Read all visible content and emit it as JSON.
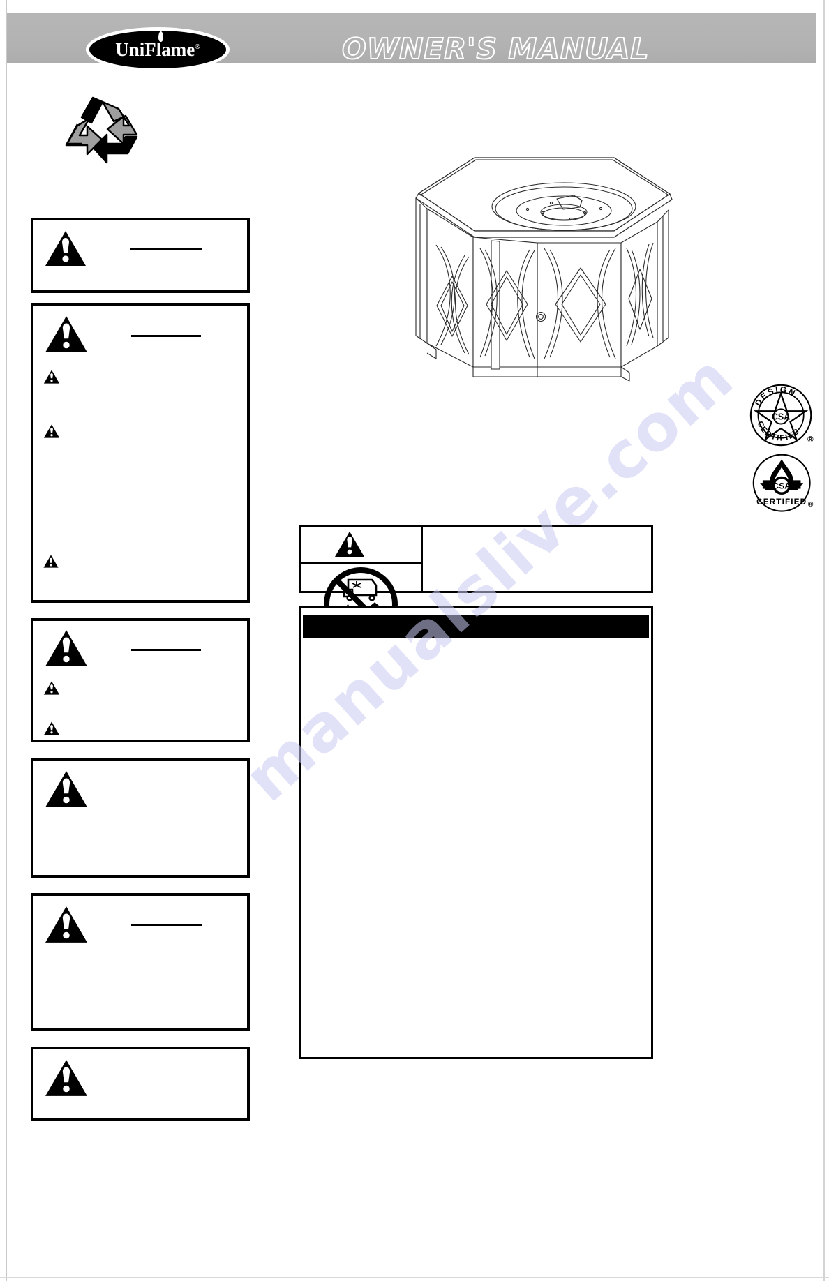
{
  "document": {
    "type": "owners-manual-cover",
    "brand": "UniFlame",
    "brand_registered_mark": "®",
    "title": "OWNER'S MANUAL",
    "watermark": "manualslive.com",
    "page_background": "#ffffff",
    "header_background": "#b3b3b3",
    "ink_color": "#000000"
  },
  "icons": {
    "recycle": "recycle-symbol",
    "warning": "warning-triangle-icon",
    "prohibition": "no-indoor-use-icon"
  },
  "badges": [
    {
      "name": "design-certified-badge",
      "top_text": "DESIGN",
      "bottom_text": "CERTIFIED",
      "mark": "®",
      "emblem": "csa-star-emblem",
      "emblem_letters": "CSA"
    },
    {
      "name": "csa-flame-certified-badge",
      "bottom_text": "CERTIFIED",
      "mark": "®",
      "emblem": "csa-flame-emblem",
      "emblem_letters": "CSA"
    }
  ],
  "illustration": {
    "name": "hexagonal-gas-fire-pit-table",
    "description": "line drawing of hexagonal fire pit table with diamond lattice side panels, burner ring and access door"
  },
  "warning_boxes": [
    {
      "id": "warning-box-1",
      "heading_rule": true,
      "bullets": 0
    },
    {
      "id": "warning-box-2",
      "heading_rule": true,
      "bullets": 3
    },
    {
      "id": "warning-box-3",
      "heading_rule": true,
      "bullets": 2
    },
    {
      "id": "warning-box-4",
      "heading_rule": false,
      "bullets": 0
    },
    {
      "id": "warning-box-5",
      "heading_rule": true,
      "bullets": 0
    },
    {
      "id": "warning-box-6",
      "heading_rule": false,
      "bullets": 0
    }
  ],
  "prohibition_box": {
    "id": "prohibition-notice-box",
    "symbol": "no-indoor-use-icon",
    "depicts": [
      "recreational-vehicle",
      "tent",
      "house"
    ]
  },
  "notice_box": {
    "id": "notice-panel",
    "header_bar": true,
    "header_bar_color": "#000000"
  }
}
